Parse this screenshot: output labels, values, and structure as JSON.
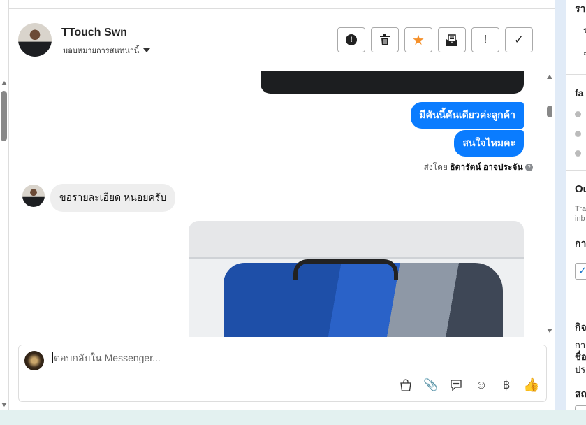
{
  "header": {
    "contact_name": "TTouch Swn",
    "assign_label": "มอบหมายการสนทนานี้",
    "actions": [
      {
        "name": "spam",
        "icon": "alert-circle-icon",
        "glyph": "!"
      },
      {
        "name": "delete",
        "icon": "trash-icon",
        "glyph": "🗑"
      },
      {
        "name": "star",
        "icon": "star-icon",
        "glyph": "★",
        "color": "#f5902a"
      },
      {
        "name": "mark-unread",
        "icon": "envelope-open-icon",
        "glyph": "✉"
      },
      {
        "name": "follow-up",
        "icon": "exclamation-icon",
        "glyph": "!"
      },
      {
        "name": "done",
        "icon": "check-icon",
        "glyph": "✓"
      }
    ]
  },
  "messages": {
    "outgoing": [
      "มีคันนี้คันเดียวค่ะลูกค้า",
      "สนใจไหมคะ"
    ],
    "sent_by_prefix": "ส่งโดย",
    "sent_by_name": "ธิดารัตน์ อาจประจัน",
    "incoming": "ขอรายละเอียด หน่อยครับ"
  },
  "composer": {
    "placeholder": "ตอบกลับใน Messenger...",
    "icons": [
      "shopping-bag-icon",
      "paperclip-icon",
      "chat-bubble-icon",
      "emoji-icon",
      "baht-icon",
      "thumbs-up-icon"
    ]
  },
  "right_panel": {
    "t1": "รา",
    "t2": "ร",
    "t3": "ะ",
    "t4": "fa",
    "t5": "Ou",
    "t6": "Tra",
    "t7": "inb",
    "t8": "กา",
    "t9": "กิจ",
    "t10": "กา",
    "t11": "ชื่อ",
    "t12": "ประ",
    "t13": "สถ"
  },
  "colors": {
    "accent": "#0a7cff",
    "star": "#f5902a"
  }
}
